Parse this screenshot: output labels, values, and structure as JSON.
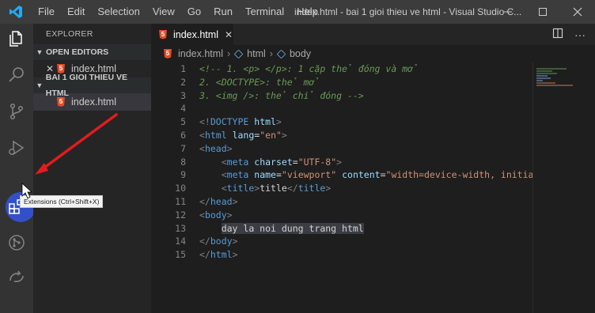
{
  "titlebar": {
    "menu": [
      "File",
      "Edit",
      "Selection",
      "View",
      "Go",
      "Run",
      "Terminal",
      "Help"
    ],
    "window_title": "index.html - bai 1 gioi thieu ve html - Visual Studio C..."
  },
  "sidebar": {
    "header": "EXPLORER",
    "open_editors": {
      "title": "OPEN EDITORS",
      "files": [
        {
          "name": "index.html"
        }
      ]
    },
    "folder": {
      "title": "BAI 1 GIOI THIEU VE HTML",
      "files": [
        {
          "name": "index.html"
        }
      ]
    }
  },
  "editor": {
    "tab_label": "index.html",
    "breadcrumb": [
      "index.html",
      "html",
      "body"
    ],
    "line_numbers": [
      "1",
      "2",
      "3",
      "4",
      "5",
      "6",
      "7",
      "8",
      "9",
      "10",
      "11",
      "12",
      "13",
      "14",
      "15"
    ],
    "code": {
      "l1": "<!-- 1. <p> </p>: 1 cặp thẻ đóng và mở",
      "l2": "2. <DOCTYPE>: thẻ mở",
      "l3": "3. <img />: thẻ chỉ đóng -->",
      "l5_open": "<!",
      "l5_kw": "DOCTYPE",
      "l5_attr": "html",
      "l5_close": ">",
      "l6_tag": "html",
      "l6_attr": "lang",
      "l6_val": "\"en\"",
      "l7_tag": "head",
      "l8_tag": "meta",
      "l8_attr": "charset",
      "l8_val": "\"UTF-8\"",
      "l9_tag": "meta",
      "l9_attr1": "name",
      "l9_val1": "\"viewport\"",
      "l9_attr2": "content",
      "l9_val2": "\"width=device-width, initial-s",
      "l10_tag": "title",
      "l10_text": "title",
      "l11_tag": "head",
      "l12_tag": "body",
      "l13_text": "day la noi dung trang html",
      "l14_tag": "body",
      "l15_tag": "html"
    }
  },
  "tooltip": "Extensions (Ctrl+Shift+X)",
  "colors": {
    "activity_bar": "#333333",
    "sidebar": "#252526",
    "editor": "#1e1e1e",
    "highlight_circle": "#3456e6",
    "annotation_arrow": "#e51b1b"
  },
  "icons": [
    "vscode-logo-icon",
    "explorer-icon",
    "search-icon",
    "source-control-icon",
    "run-debug-icon",
    "extensions-icon",
    "git-graph-icon",
    "remote-icon",
    "split-editor-icon",
    "more-actions-icon"
  ]
}
